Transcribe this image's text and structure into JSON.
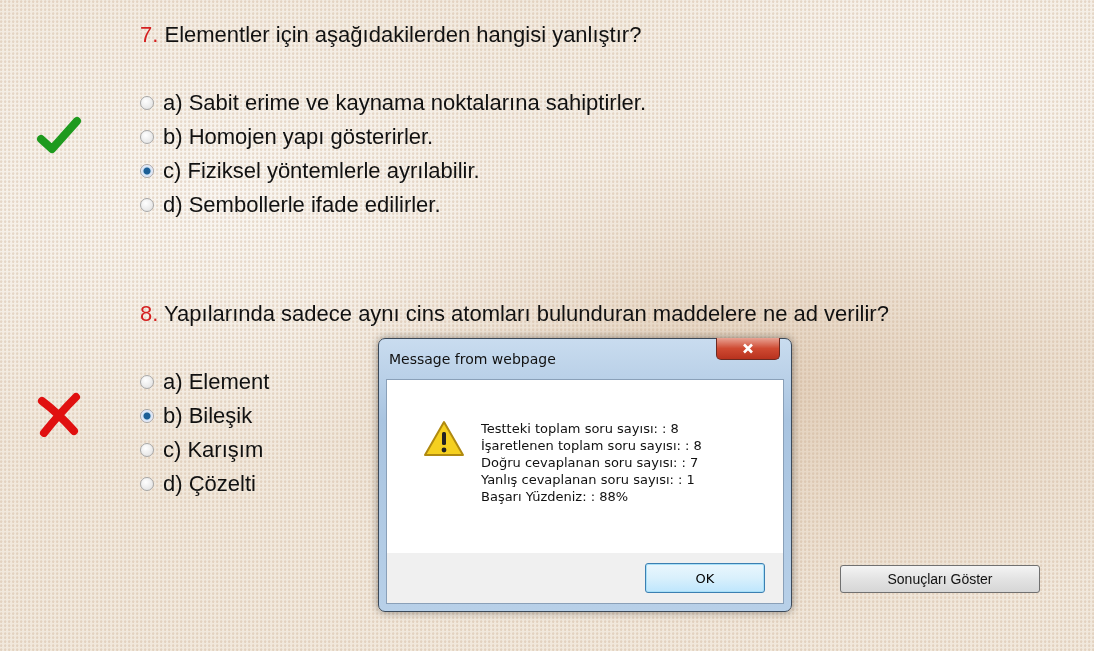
{
  "questions": [
    {
      "number": "7.",
      "text": "Elementler için aşağıdakilerden hangisi yanlıştır?",
      "correct": true,
      "options": [
        {
          "label": "a) Sabit erime ve kaynama noktalarına sahiptirler.",
          "selected": false
        },
        {
          "label": "b) Homojen yapı gösterirler.",
          "selected": false
        },
        {
          "label": "c) Fiziksel yöntemlerle ayrılabilir.",
          "selected": true
        },
        {
          "label": "d) Sembollerle ifade edilirler.",
          "selected": false
        }
      ]
    },
    {
      "number": "8.",
      "text": "Yapılarında sadece aynı cins atomları bulunduran maddelere ne ad verilir?",
      "correct": false,
      "options": [
        {
          "label": "a) Element",
          "selected": false
        },
        {
          "label": "b) Bileşik",
          "selected": true
        },
        {
          "label": "c) Karışım",
          "selected": false
        },
        {
          "label": "d) Çözelti",
          "selected": false
        }
      ]
    }
  ],
  "results_button": "Sonuçları Göster",
  "dialog": {
    "title": "Message from webpage",
    "lines": [
      "Testteki toplam soru sayısı: : 8",
      "İşaretlenen toplam soru sayısı: : 8",
      "Doğru cevaplanan soru sayısı: : 7",
      "Yanlış cevaplanan soru sayısı: : 1",
      "Başarı Yüzdeniz: : 88%"
    ],
    "ok_button": "OK"
  }
}
